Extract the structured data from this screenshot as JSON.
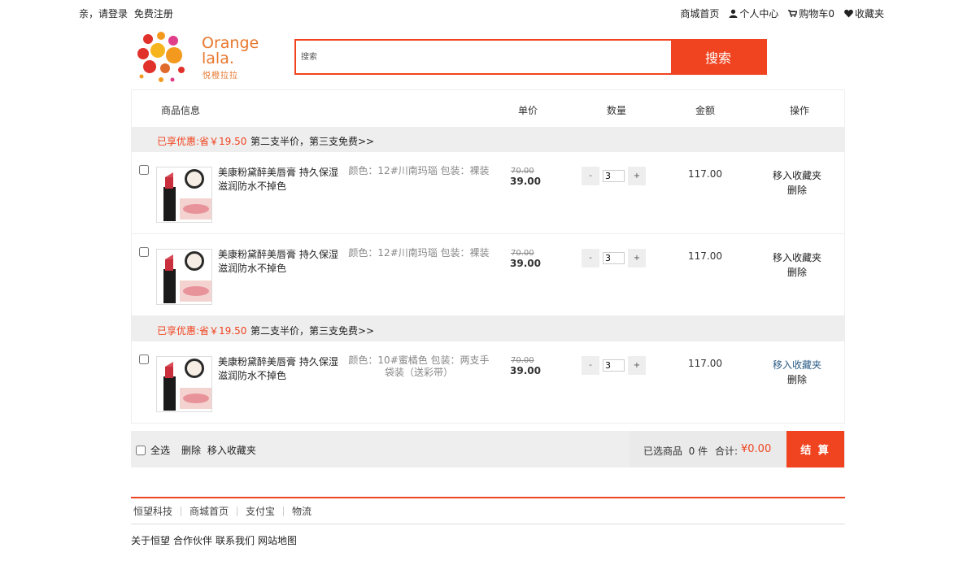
{
  "topbar": {
    "greeting": "亲，请登录",
    "register": "免费注册",
    "home": "商城首页",
    "profile": "个人中心",
    "cart": "购物车0",
    "favorites": "收藏夹"
  },
  "logo": {
    "brand_line1": "Orange",
    "brand_line2": "lala.",
    "cn": "悦橙拉拉"
  },
  "search": {
    "placeholder": "搜索",
    "button": "搜索"
  },
  "cart_head": {
    "info": "商品信息",
    "unit_price": "单价",
    "qty": "数量",
    "amount": "金额",
    "ops": "操作"
  },
  "groups": [
    {
      "promo": {
        "discount": "已享优惠:省￥19.50",
        "rule": "第二支半价，第三支免费>>"
      },
      "items": [
        {
          "name": "美康粉黛醉美唇膏 持久保湿滋润防水不掉色",
          "spec": "颜色：12#川南玛瑙 包装：裸装",
          "old_price": "70.00",
          "price": "39.00",
          "qty": "3",
          "sum": "117.00",
          "fav": "移入收藏夹",
          "del": "删除"
        },
        {
          "name": "美康粉黛醉美唇膏 持久保湿滋润防水不掉色",
          "spec": "颜色：12#川南玛瑙 包装：裸装",
          "old_price": "70.00",
          "price": "39.00",
          "qty": "3",
          "sum": "117.00",
          "fav": "移入收藏夹",
          "del": "删除"
        }
      ]
    },
    {
      "promo": {
        "discount": "已享优惠:省￥19.50",
        "rule": "第二支半价，第三支免费>>"
      },
      "items": [
        {
          "name": "美康粉黛醉美唇膏 持久保湿滋润防水不掉色",
          "spec": "颜色：10#蜜橘色 包装：两支手袋装（送彩带）",
          "old_price": "70.00",
          "price": "39.00",
          "qty": "3",
          "sum": "117.00",
          "fav": "移入收藏夹",
          "del": "删除"
        }
      ]
    }
  ],
  "qty_minus": "-",
  "qty_plus": "+",
  "cart_footer": {
    "select_all": "全选",
    "delete": "删除",
    "move_fav": "移入收藏夹",
    "selected_label": "已选商品",
    "selected_count": "0 件",
    "total_label": "合计:",
    "total_value": "¥0.00",
    "checkout": "结 算"
  },
  "page_footer": {
    "links": [
      "恒望科技",
      "商城首页",
      "支付宝",
      "物流"
    ],
    "bottom": [
      "关于恒望",
      "合作伙伴",
      "联系我们",
      "网站地图"
    ]
  },
  "colors": {
    "accent": "#f0431f",
    "brand": "#e8772e",
    "panel": "#eeeeee"
  }
}
